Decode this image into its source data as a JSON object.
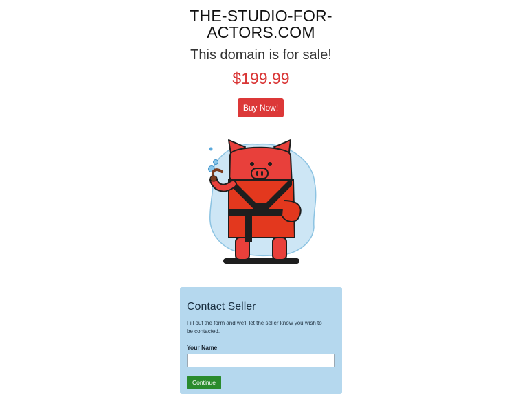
{
  "header": {
    "domain_line1": "THE-STUDIO-FOR-",
    "domain_line2": "ACTORS.COM",
    "sale_text": "This domain is for sale!",
    "price": "$199.99",
    "buy_label": "Buy Now!"
  },
  "mascot": {
    "icon": "pig-in-robe-illustration",
    "colors": {
      "pig": "#e8403b",
      "robe": "#e3381e",
      "blob": "#cde6f5",
      "outline": "#1e1e1e"
    }
  },
  "contact": {
    "title": "Contact Seller",
    "description": "Fill out the form and we'll let the seller know you wish to be contacted.",
    "name_label": "Your Name",
    "name_value": "",
    "continue_label": "Continue"
  },
  "colors": {
    "accent_red": "#dc3838",
    "card_bg": "#b5d8ee",
    "continue_green": "#2a8b2d"
  }
}
